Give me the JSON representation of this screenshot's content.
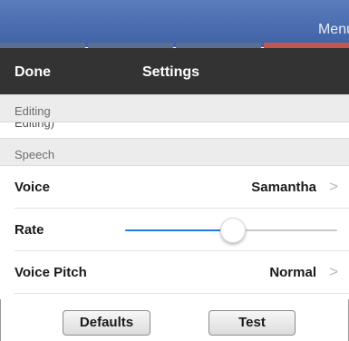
{
  "app_bar": {
    "menu_label": "Menu"
  },
  "header": {
    "done_label": "Done",
    "title": "Settings"
  },
  "sections": {
    "editing": {
      "title": "Editing",
      "partial_row": "Editing)"
    },
    "speech": {
      "title": "Speech"
    }
  },
  "voice": {
    "label": "Voice",
    "value": "Samantha",
    "chevron": ">"
  },
  "rate": {
    "label": "Rate",
    "level_fraction": 0.51
  },
  "pitch": {
    "label": "Voice Pitch",
    "value": "Normal",
    "chevron": ">"
  },
  "buttons": {
    "defaults_label": "Defaults",
    "test_label": "Test"
  },
  "colors": {
    "accent": "#1e7cf2",
    "header_bg": "#333333",
    "app_bar": "#4a6db0"
  }
}
